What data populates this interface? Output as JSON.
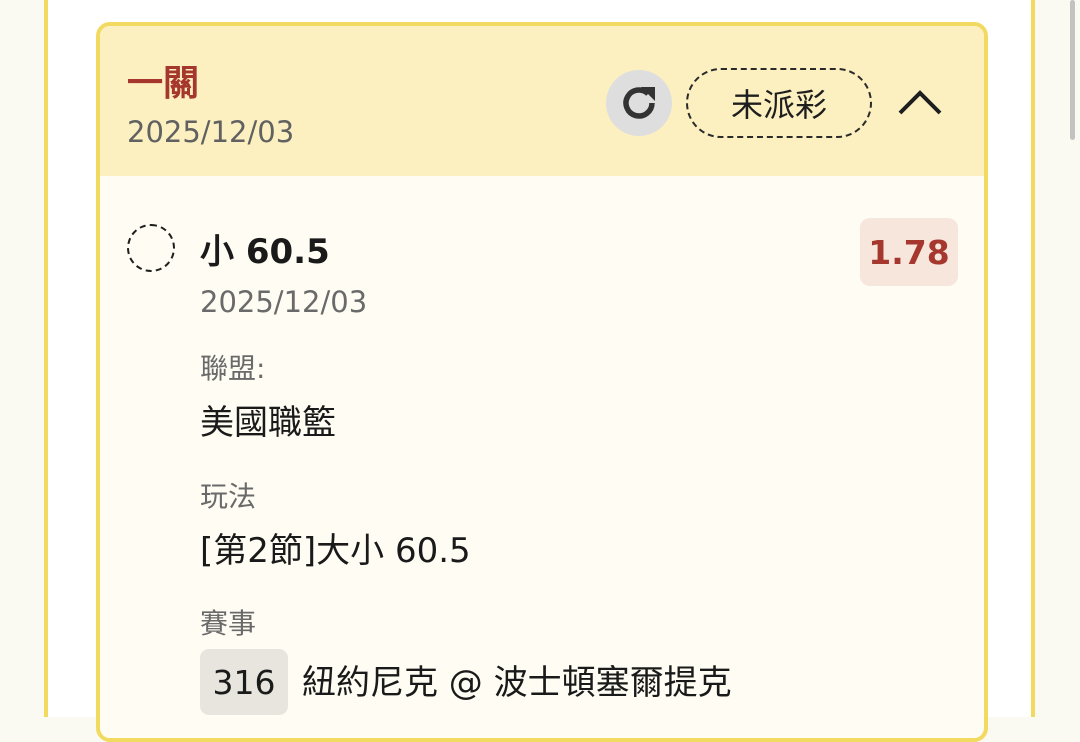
{
  "bet": {
    "type": "一關",
    "date": "2025/12/03",
    "status": "未派彩"
  },
  "selection": {
    "title": "小 60.5",
    "date": "2025/12/03",
    "odds": "1.78"
  },
  "details": {
    "league_label": "聯盟:",
    "league_value": "美國職籃",
    "play_label": "玩法",
    "play_value": "[第2節]大小 60.5",
    "match_label": "賽事",
    "match_id": "316",
    "match_name": "紐約尼克 @ 波士頓塞爾提克"
  },
  "icons": {
    "refresh": "refresh-icon",
    "collapse": "chevron-up-icon",
    "radio": "unchecked-radio-icon"
  },
  "colors": {
    "accent": "#a5372f",
    "card_border": "#f1da5f",
    "header_bg": "#fcf0c1",
    "card_bg": "#fffdf3",
    "odds_bg": "#f7e6dc"
  }
}
